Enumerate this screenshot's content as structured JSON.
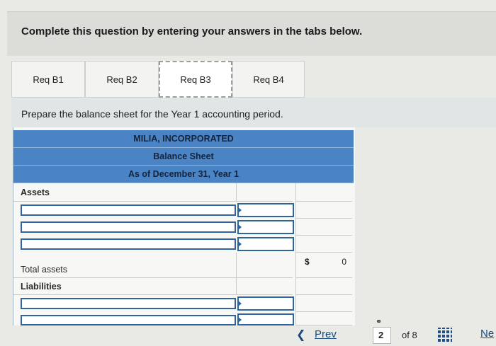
{
  "banner": {
    "text": "Complete this question by entering your answers in the tabs below."
  },
  "tabs": [
    {
      "label": "Req B1",
      "active": false
    },
    {
      "label": "Req B2",
      "active": false
    },
    {
      "label": "Req B3",
      "active": true
    },
    {
      "label": "Req B4",
      "active": false
    }
  ],
  "instruction": "Prepare the balance sheet for the Year 1 accounting period.",
  "sheet": {
    "company": "MILIA, INCORPORATED",
    "statement": "Balance Sheet",
    "date": "As of December 31, Year 1",
    "assets_label": "Assets",
    "total_assets_label": "Total assets",
    "total_assets_currency": "$",
    "total_assets_value": "0",
    "liabilities_label": "Liabilities"
  },
  "nav": {
    "prev_label": "Prev",
    "page_current": "2",
    "page_of": "of 8",
    "next_label": "Ne"
  }
}
